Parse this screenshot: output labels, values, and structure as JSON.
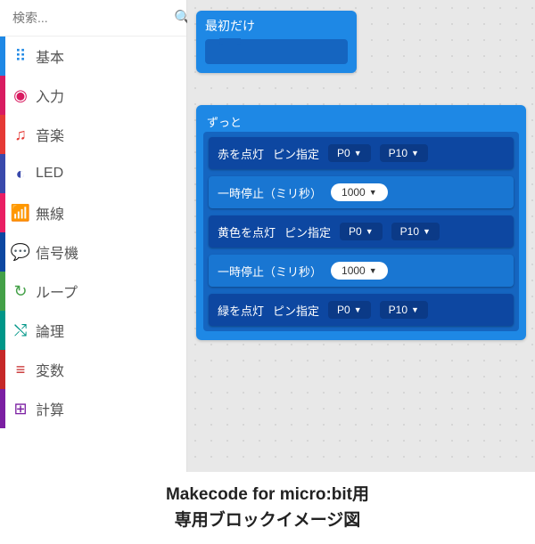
{
  "search": {
    "placeholder": "検索..."
  },
  "categories": [
    {
      "label": "基本",
      "color": "#1e88e5",
      "iconColor": "#1e88e5",
      "icon": "⠿"
    },
    {
      "label": "入力",
      "color": "#d81b60",
      "iconColor": "#d81b60",
      "icon": "◉"
    },
    {
      "label": "音楽",
      "color": "#e53935",
      "iconColor": "#e53935",
      "icon": "♫"
    },
    {
      "label": "LED",
      "color": "#3949ab",
      "iconColor": "#3949ab",
      "icon": "◐"
    },
    {
      "label": "無線",
      "color": "#e91e63",
      "iconColor": "#e91e63",
      "icon": "📶"
    },
    {
      "label": "信号機",
      "color": "#0d47a1",
      "iconColor": "#0d47a1",
      "icon": "💬"
    },
    {
      "label": "ループ",
      "color": "#43a047",
      "iconColor": "#43a047",
      "icon": "↻"
    },
    {
      "label": "論理",
      "color": "#009688",
      "iconColor": "#009688",
      "icon": "⤭"
    },
    {
      "label": "変数",
      "color": "#c62828",
      "iconColor": "#c62828",
      "icon": "≡"
    },
    {
      "label": "計算",
      "color": "#7b1fa2",
      "iconColor": "#7b1fa2",
      "icon": "⊞"
    }
  ],
  "hat_block": {
    "label": "最初だけ"
  },
  "forever_block": {
    "label": "ずっと",
    "blocks": [
      {
        "type": "light",
        "label": "赤を点灯",
        "pin_label": "ピン指定",
        "pin1": "P0",
        "pin2": "P10"
      },
      {
        "type": "pause",
        "label": "一時停止（ミリ秒）",
        "value": "1000"
      },
      {
        "type": "light",
        "label": "黄色を点灯",
        "pin_label": "ピン指定",
        "pin1": "P0",
        "pin2": "P10"
      },
      {
        "type": "pause",
        "label": "一時停止（ミリ秒）",
        "value": "1000"
      },
      {
        "type": "light",
        "label": "緑を点灯",
        "pin_label": "ピン指定",
        "pin1": "P0",
        "pin2": "P10"
      }
    ]
  },
  "caption": {
    "line1": "Makecode for micro:bit用",
    "line2": "専用ブロックイメージ図"
  }
}
